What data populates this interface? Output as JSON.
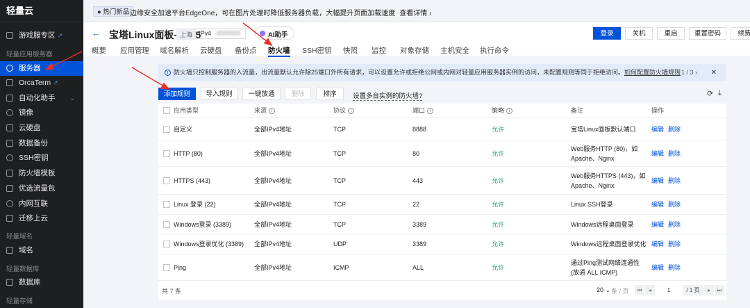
{
  "sidebar": {
    "logo": "轻量云",
    "game_zone": "游戏服专区",
    "groups": [
      "轻量应用服务器",
      "轻量域名",
      "轻量数据库",
      "轻量存储"
    ],
    "items": [
      "服务器",
      "OrcaTerm",
      "自动化助手",
      "镜像",
      "云硬盘",
      "数据备份",
      "SSH密钥",
      "防火墙模板",
      "优选流量包",
      "内网互联",
      "迁移上云"
    ],
    "domain": "域名",
    "database": "数据库"
  },
  "topbar": {
    "badge": "● 热门新品",
    "notice": "边缘安全加速平台EdgeOne，可在图片处理时降低服务器负载，大幅提升页面加载速度",
    "more": "查看详情 ›"
  },
  "header": {
    "title": "宝塔Linux面板-RL85",
    "region": "上海",
    "ipv4_label": "IPv4",
    "ai": "AI助手",
    "buttons": [
      "登录",
      "关机",
      "重启",
      "重置密码",
      "续费"
    ],
    "tabs": [
      "概要",
      "应用管理",
      "域名解析",
      "云硬盘",
      "备份点",
      "防火墙",
      "SSH密钥",
      "快照",
      "监控",
      "对象存储",
      "主机安全",
      "执行命令"
    ]
  },
  "info": {
    "text": "防火墙只控制服务器的入流量，出流量默认允许除25端口外所有请求，可以设置允许或拒绝公网或内网对轻量应用服务器实例的访问，未配置规则等同于拒绝访问。",
    "link": "如何配置防火墙规则",
    "pager": "‹  1 / 3  ›",
    "close": "✕"
  },
  "toolbar": {
    "add": "添加规则",
    "import": "导入规则",
    "open_all": "一键放通",
    "delete": "删除",
    "sort": "排序",
    "multi": "设置多台实例的防火墙?"
  },
  "table": {
    "headers": [
      "应用类型",
      "来源",
      "协议",
      "端口",
      "策略",
      "备注",
      "操作"
    ],
    "rows": [
      [
        "自定义",
        "全部IPv4地址",
        "TCP",
        "8888",
        "允许",
        "宝塔Linux面板默认端口"
      ],
      [
        "HTTP (80)",
        "全部IPv4地址",
        "TCP",
        "80",
        "允许",
        "Web服务HTTP (80)，如 Apache、Nginx"
      ],
      [
        "HTTPS (443)",
        "全部IPv4地址",
        "TCP",
        "443",
        "允许",
        "Web服务HTTPS (443)，如 Apache、Nginx"
      ],
      [
        "Linux 登录 (22)",
        "全部IPv4地址",
        "TCP",
        "22",
        "允许",
        "Linux SSH登录"
      ],
      [
        "Windows登录 (3389)",
        "全部IPv4地址",
        "TCP",
        "3389",
        "允许",
        "Windows远程桌面登录"
      ],
      [
        "Windows登录优化 (3389)",
        "全部IPv4地址",
        "UDP",
        "3389",
        "允许",
        "Windows远程桌面登录优化"
      ],
      [
        "Ping",
        "全部IPv4地址",
        "ICMP",
        "ALL",
        "允许",
        "通过Ping测试网络连通性 (放通 ALL ICMP)"
      ]
    ],
    "edit": "编辑",
    "remove": "删除"
  },
  "footer": {
    "total": "共 7 条",
    "page_size": "20 ⌄",
    "per_page": "条 / 页",
    "page": "1",
    "pages": "/ 1 页"
  }
}
